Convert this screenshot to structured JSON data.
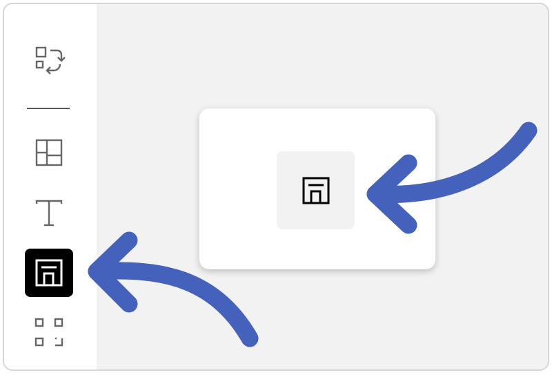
{
  "sidebar": {
    "tools": [
      {
        "name": "swap-icon",
        "active": false
      },
      {
        "name": "layout-icon",
        "active": false
      },
      {
        "name": "text-icon",
        "active": false
      },
      {
        "name": "frame-icon",
        "active": true
      },
      {
        "name": "scan-icon",
        "active": false
      }
    ]
  },
  "popup": {
    "tool": "frame-icon"
  },
  "annotations": {
    "arrow_color": "#4462bb",
    "arrows": [
      "arrow-to-popup-tool",
      "arrow-to-sidebar-tool"
    ]
  },
  "colors": {
    "active_tool_bg": "#000000",
    "canvas_bg": "#f2f2f2",
    "sidebar_bg": "#ffffff"
  }
}
